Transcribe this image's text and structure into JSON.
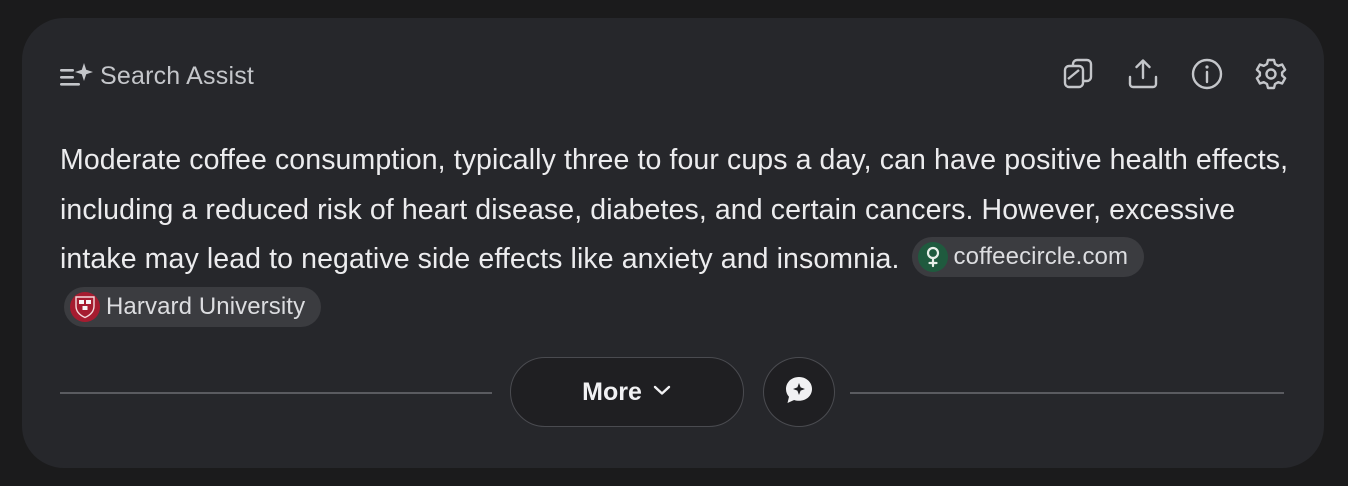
{
  "header": {
    "title": "Search Assist",
    "title_icon": "sparkle-list-icon",
    "actions": [
      {
        "name": "copy-icon"
      },
      {
        "name": "share-icon"
      },
      {
        "name": "info-icon"
      },
      {
        "name": "settings-icon"
      }
    ]
  },
  "answer": {
    "text": "Moderate coffee consumption, typically three to four cups a day, can have positive health effects, including a reduced risk of heart disease, diabetes, and certain cancers. However, excessive intake may lead to negative side effects like anxiety and insomnia."
  },
  "sources": [
    {
      "label": "coffeecircle.com",
      "icon": "coffeecircle-favicon",
      "color": "#1f5a3e"
    },
    {
      "label": "Harvard University",
      "icon": "harvard-shield-favicon",
      "color": "#a51c30"
    }
  ],
  "footer": {
    "more_label": "More",
    "more_icon": "chevron-down-icon",
    "feedback_icon": "feedback-bubble-icon"
  },
  "colors": {
    "page_background": "#1b1b1c",
    "card_background": "#26272b",
    "chip_background": "#3b3c40",
    "text_primary": "#ececee"
  }
}
